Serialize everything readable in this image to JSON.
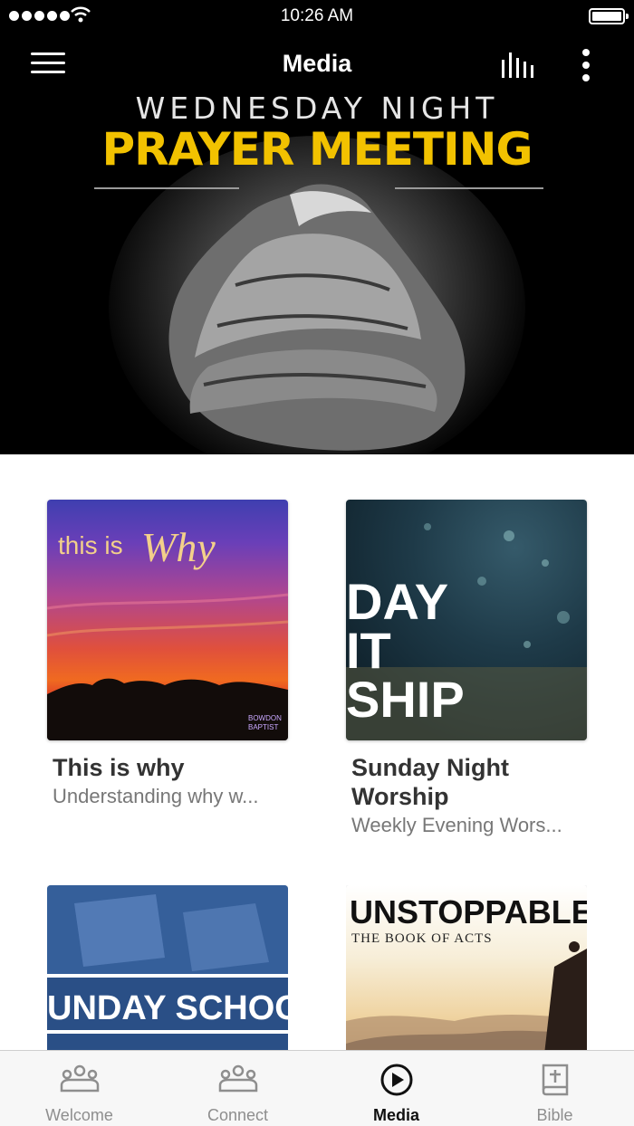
{
  "status_bar": {
    "time": "10:26 AM"
  },
  "nav": {
    "title": "Media"
  },
  "hero": {
    "line1": "WEDNESDAY NIGHT",
    "line2": "PRAYER MEETING"
  },
  "grid": [
    {
      "title": "This is why",
      "subtitle": "Understanding why w...",
      "art_text_a": "this is",
      "art_text_b": "Why",
      "art_logo_a": "BOWDON",
      "art_logo_b": "BAPTIST"
    },
    {
      "title": "Sunday Night Worship",
      "subtitle": "Weekly Evening Wors...",
      "art_lines": [
        "DAY",
        "IT",
        "SHIP"
      ]
    },
    {
      "title": "",
      "subtitle": "",
      "art_text": "UNDAY SCHOO"
    },
    {
      "title": "",
      "subtitle": "",
      "art_text_a": "UNSTOPPABLE",
      "art_text_b": "THE BOOK OF ACTS"
    }
  ],
  "tabs": [
    {
      "label": "Welcome",
      "icon": "people-icon",
      "active": false
    },
    {
      "label": "Connect",
      "icon": "people-icon",
      "active": false
    },
    {
      "label": "Media",
      "icon": "play-circle-icon",
      "active": true
    },
    {
      "label": "Bible",
      "icon": "bible-icon",
      "active": false
    }
  ],
  "colors": {
    "hero_title": "#f2c200",
    "active_tab": "#111111",
    "inactive_tab": "#8e8e8e"
  }
}
